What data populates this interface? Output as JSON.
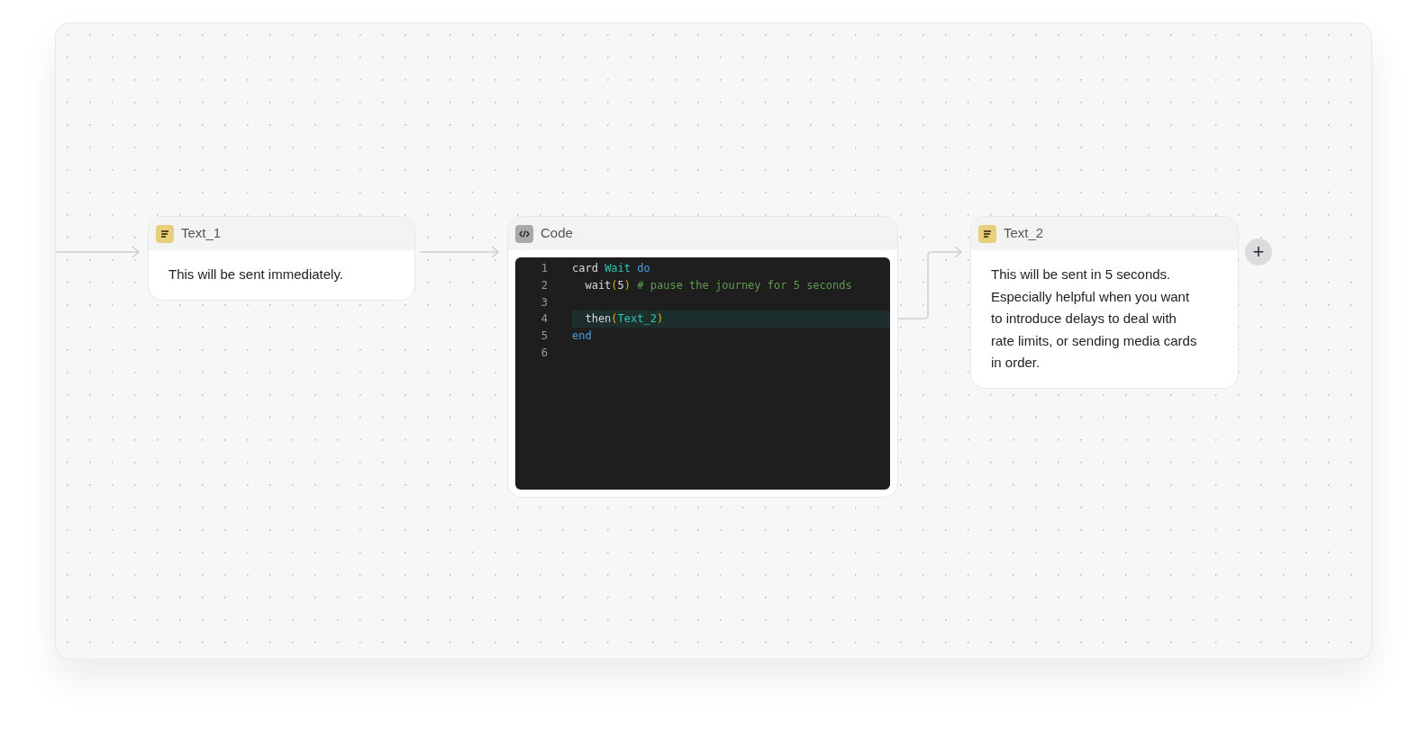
{
  "nodes": [
    {
      "kind": "text",
      "title": "Text_1",
      "body": "This will be sent immediately."
    },
    {
      "kind": "code",
      "title": "Code",
      "lines": [
        {
          "number": "1",
          "tokens": [
            {
              "text": "card ",
              "kind": "plain"
            },
            {
              "text": "Wait",
              "kind": "name"
            },
            {
              "text": " do",
              "kind": "keyword"
            }
          ],
          "highlighted": false
        },
        {
          "number": "2",
          "tokens": [
            {
              "text": "  wait",
              "kind": "plain"
            },
            {
              "text": "(",
              "kind": "paren"
            },
            {
              "text": "5",
              "kind": "plain"
            },
            {
              "text": ")",
              "kind": "paren"
            },
            {
              "text": " # pause the journey for 5 seconds",
              "kind": "comment"
            }
          ],
          "highlighted": false
        },
        {
          "number": "3",
          "highlighted": false
        },
        {
          "number": "4",
          "tokens": [
            {
              "text": "  then",
              "kind": "plain"
            },
            {
              "text": "(",
              "kind": "paren"
            },
            {
              "text": "Text_2",
              "kind": "name"
            },
            {
              "text": ")",
              "kind": "paren"
            }
          ],
          "highlighted": true
        },
        {
          "number": "5",
          "tokens": [
            {
              "text": "end",
              "kind": "keyword"
            }
          ],
          "highlighted": false
        },
        {
          "number": "6",
          "highlighted": false
        }
      ]
    },
    {
      "kind": "text",
      "title": "Text_2",
      "body": "This will be sent in 5 seconds. Especially helpful when you want to introduce delays to deal with rate limits, or sending media cards in order."
    }
  ],
  "add_button": {
    "label": "+"
  }
}
